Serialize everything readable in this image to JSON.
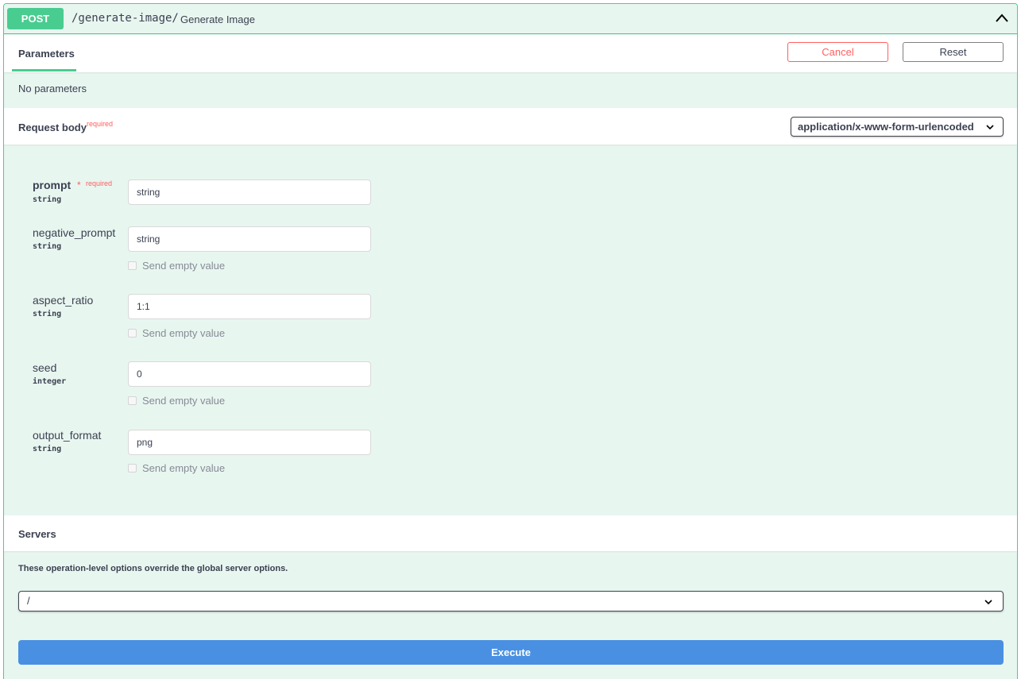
{
  "operation": {
    "method": "POST",
    "path": "/generate-image/",
    "summary": "Generate Image",
    "accent_color": "#49cc90"
  },
  "parameters": {
    "tab_label": "Parameters",
    "cancel_label": "Cancel",
    "reset_label": "Reset",
    "empty_text": "No parameters"
  },
  "request_body": {
    "title": "Request body",
    "required_label": "required",
    "content_type": "application/x-www-form-urlencoded",
    "fields": [
      {
        "name": "prompt",
        "required_star": "*",
        "required_label": "required",
        "type": "string",
        "value": "string"
      },
      {
        "name": "negative_prompt",
        "type": "string",
        "value": "string",
        "empty_label": "Send empty value"
      },
      {
        "name": "aspect_ratio",
        "type": "string",
        "value": "1:1",
        "empty_label": "Send empty value"
      },
      {
        "name": "seed",
        "type": "integer",
        "value": "0",
        "empty_label": "Send empty value"
      },
      {
        "name": "output_format",
        "type": "string",
        "value": "png",
        "empty_label": "Send empty value"
      }
    ]
  },
  "servers": {
    "title": "Servers",
    "note": "These operation-level options override the global server options.",
    "selected": "/"
  },
  "execute": {
    "label": "Execute",
    "color": "#4990e2"
  },
  "icons": {
    "collapse": "chevron-up-icon",
    "select": "chevron-down-icon"
  }
}
